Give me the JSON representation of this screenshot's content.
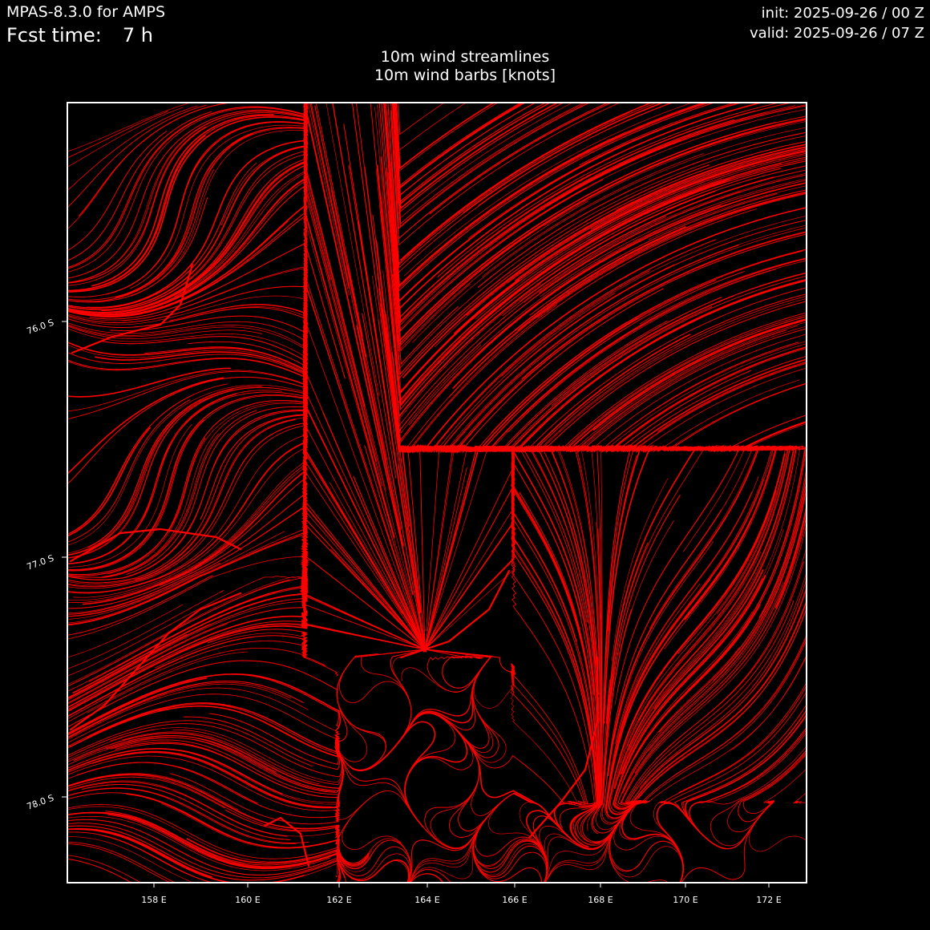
{
  "header": {
    "model": "MPAS-8.3.0 for AMPS",
    "fcst_label": "Fcst time:",
    "fcst_value": "7 h",
    "init": "init: 2025-09-26 / 00 Z",
    "valid": "valid: 2025-09-26 / 07 Z"
  },
  "titles": {
    "line1": "10m wind streamlines",
    "line2": "10m wind barbs [knots]"
  },
  "map": {
    "background": "#000000",
    "frame_color": "#ffffff",
    "streamline_color": "#ff0000",
    "lon_ticks": [
      "158 E",
      "160 E",
      "162 E",
      "164 E",
      "166 E",
      "168 E",
      "170 E",
      "172 E"
    ],
    "lat_ticks": [
      "76.0 S",
      "77.0 S",
      "78.0 S"
    ]
  }
}
